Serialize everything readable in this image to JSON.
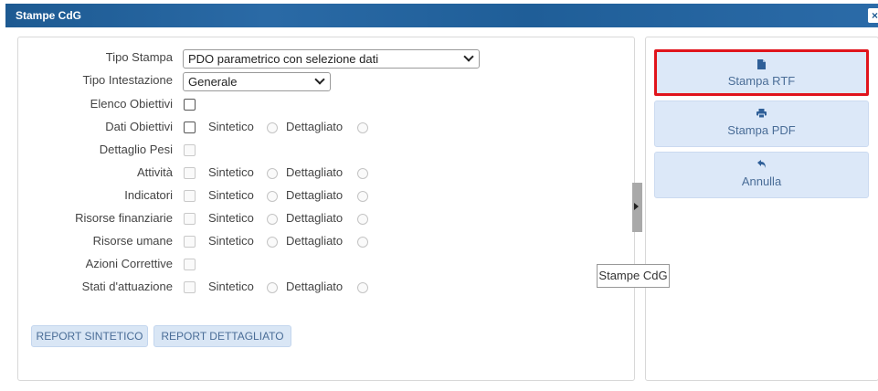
{
  "window": {
    "title": "Stampe CdG",
    "close_label": "×"
  },
  "form": {
    "tipo_stampa": {
      "label": "Tipo Stampa",
      "value": "PDO parametrico con selezione dati"
    },
    "tipo_intestazione": {
      "label": "Tipo Intestazione",
      "value": "Generale"
    },
    "elenco_obiettivi": {
      "label": "Elenco Obiettivi"
    },
    "dati_obiettivi": {
      "label": "Dati Obiettivi",
      "opt1": "Sintetico",
      "opt2": "Dettagliato"
    },
    "dettaglio_pesi": {
      "label": "Dettaglio Pesi"
    },
    "attivita": {
      "label": "Attività",
      "opt1": "Sintetico",
      "opt2": "Dettagliato"
    },
    "indicatori": {
      "label": "Indicatori",
      "opt1": "Sintetico",
      "opt2": "Dettagliato"
    },
    "risorse_finanziarie": {
      "label": "Risorse finanziarie",
      "opt1": "Sintetico",
      "opt2": "Dettagliato"
    },
    "risorse_umane": {
      "label": "Risorse umane",
      "opt1": "Sintetico",
      "opt2": "Dettagliato"
    },
    "azioni_correttive": {
      "label": "Azioni Correttive"
    },
    "stati_attuazione": {
      "label": "Stati d'attuazione",
      "opt1": "Sintetico",
      "opt2": "Dettagliato"
    }
  },
  "report_buttons": {
    "sintetico": "REPORT SINTETICO",
    "dettagliato": "REPORT DETTAGLIATO"
  },
  "actions": {
    "rtf": {
      "label": "Stampa RTF",
      "icon": "file-icon"
    },
    "pdf": {
      "label": "Stampa PDF",
      "icon": "print-icon"
    },
    "annulla": {
      "label": "Annulla",
      "icon": "undo-icon"
    }
  },
  "tooltip": "Stampe CdG",
  "colors": {
    "title_bar": "#1d5a92",
    "button_bg": "#dce8f8",
    "highlight": "#e0141c"
  }
}
